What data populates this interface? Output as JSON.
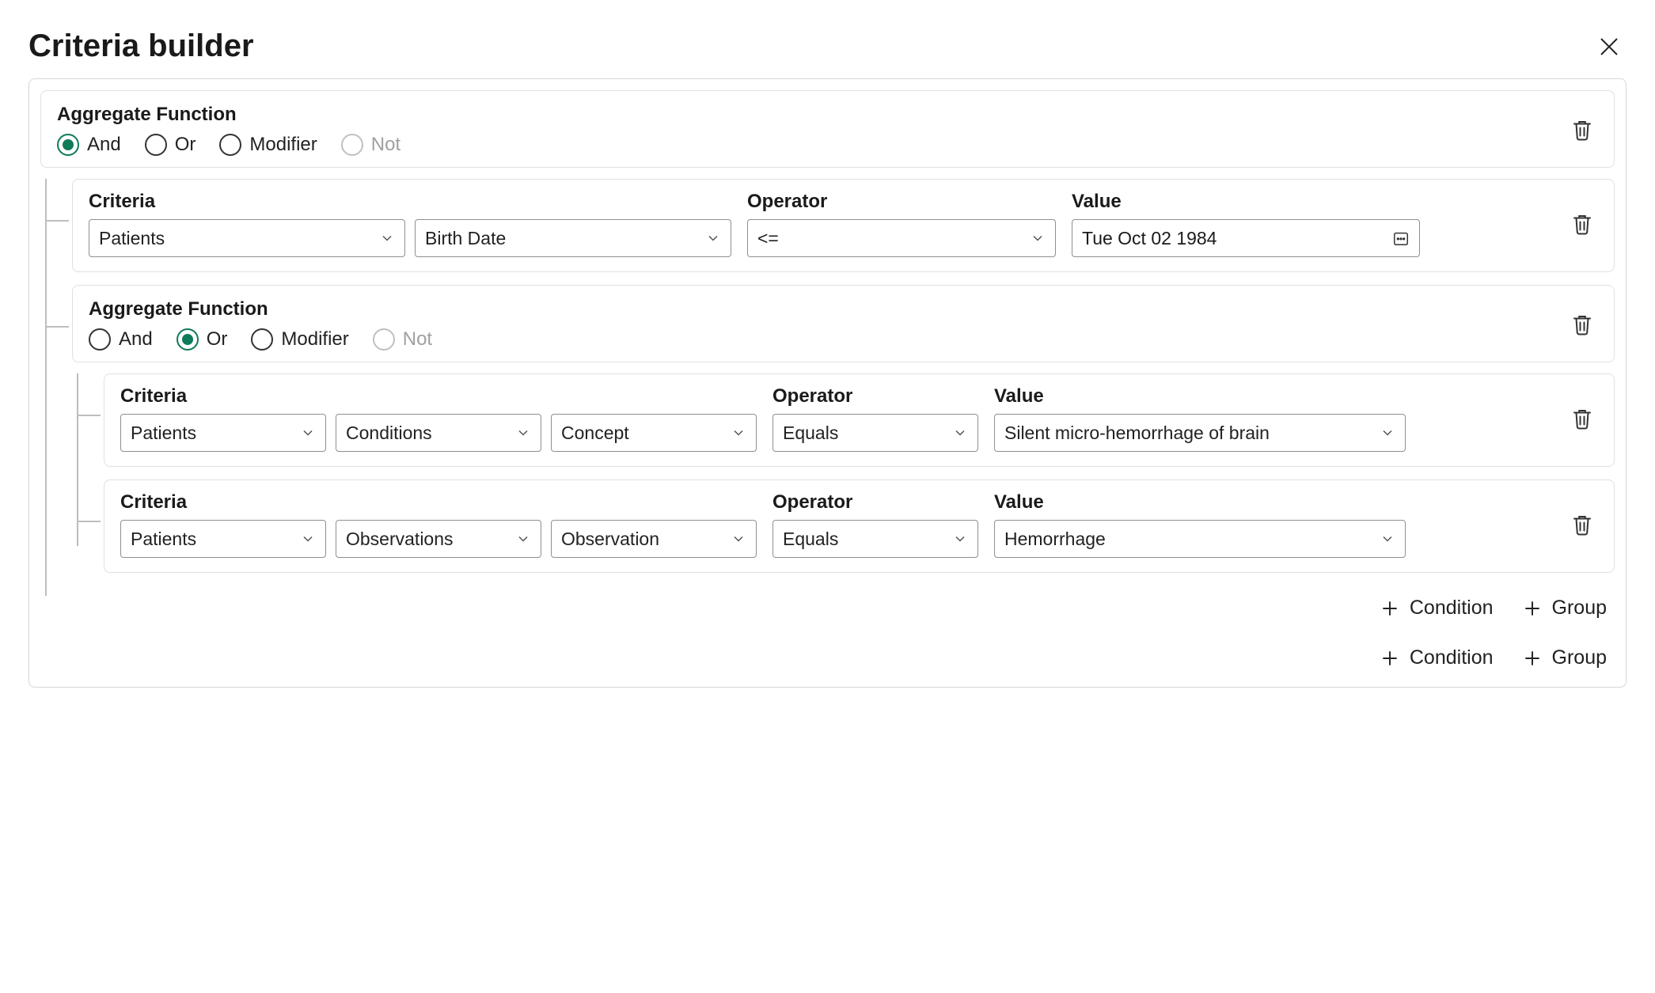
{
  "heading": "Criteria builder",
  "labels": {
    "aggregate_function": "Aggregate Function",
    "criteria": "Criteria",
    "operator": "Operator",
    "value": "Value",
    "condition_btn": "Condition",
    "group_btn": "Group"
  },
  "agg_options": {
    "and": "And",
    "or": "Or",
    "modifier": "Modifier",
    "not": "Not"
  },
  "root_group": {
    "selected": "and",
    "not_disabled": true,
    "children": {
      "row0": {
        "criteria1": "Patients",
        "criteria2": "Birth Date",
        "operator": "<=",
        "value": "Tue Oct 02 1984"
      },
      "group1": {
        "selected": "or",
        "not_disabled": true,
        "children": {
          "row0": {
            "criteria1": "Patients",
            "criteria2": "Conditions",
            "criteria3": "Concept",
            "operator": "Equals",
            "value": "Silent micro-hemorrhage of brain"
          },
          "row1": {
            "criteria1": "Patients",
            "criteria2": "Observations",
            "criteria3": "Observation",
            "operator": "Equals",
            "value": "Hemorrhage"
          }
        }
      }
    }
  }
}
